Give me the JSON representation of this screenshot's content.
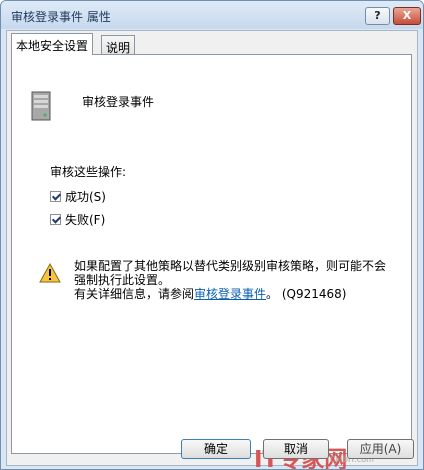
{
  "window": {
    "title": "审核登录事件 属性",
    "help_label": "?",
    "close_label": "X"
  },
  "tabs": [
    {
      "label": "本地安全设置"
    },
    {
      "label": "说明"
    }
  ],
  "panel": {
    "policy_name": "审核登录事件",
    "audit_label": "审核这些操作:",
    "success_label": "成功(S)",
    "success_checked": true,
    "failure_label": "失败(F)",
    "failure_checked": true,
    "warning_line1": "如果配置了其他策略以替代类别级别审核策略，则可能不会强制执行此设置。",
    "warning_line2_prefix": "有关详细信息，请参阅",
    "warning_link": "审核登录事件",
    "warning_line2_suffix": "。 (Q921468)"
  },
  "watermark": {
    "text": "IT专家网",
    "url": "ClubIT.com"
  },
  "buttons": {
    "ok": "确定",
    "cancel": "取消",
    "apply": "应用(A)"
  }
}
